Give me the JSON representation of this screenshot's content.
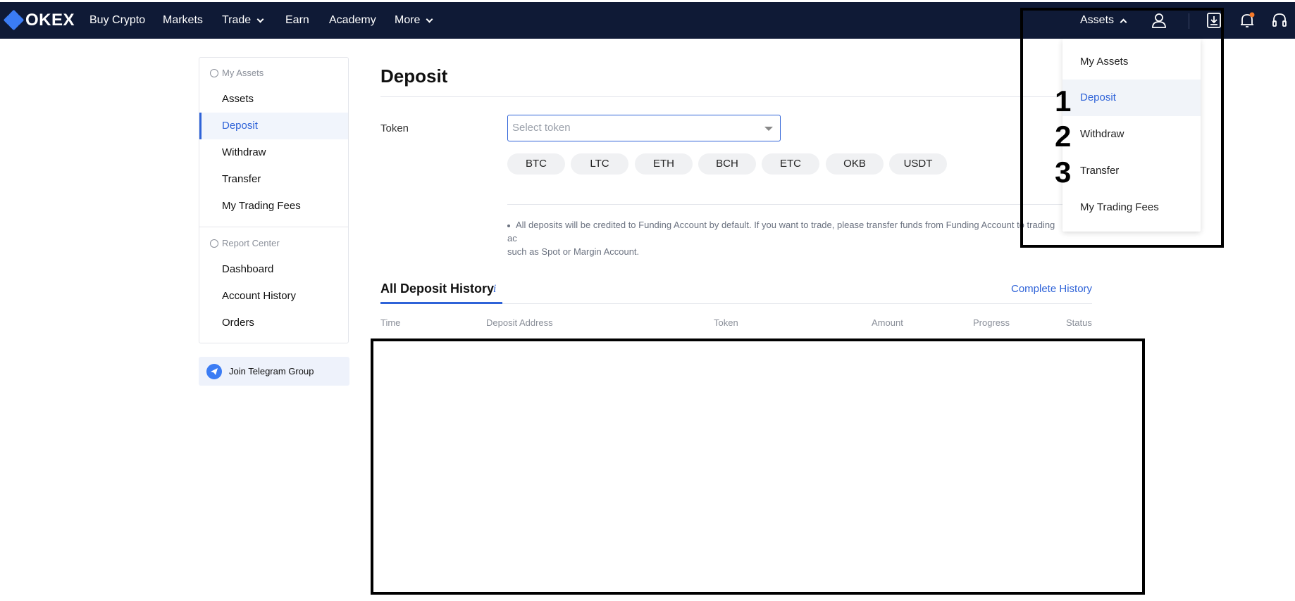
{
  "nav": {
    "logo_text": "OKEX",
    "items": [
      "Buy Crypto",
      "Markets",
      "Trade",
      "Earn",
      "Academy",
      "More"
    ],
    "assets_label": "Assets",
    "icons": [
      "user-icon",
      "download-icon",
      "bell-icon",
      "headset-icon"
    ],
    "accent_color": "#0f1a36"
  },
  "sidebar": {
    "section1": "My Assets",
    "items1": [
      "Assets",
      "Deposit",
      "Withdraw",
      "Transfer",
      "My Trading Fees"
    ],
    "section2": "Report Center",
    "items2": [
      "Dashboard",
      "Account History",
      "Orders"
    ],
    "telegram": "Join Telegram Group"
  },
  "main": {
    "title": "Deposit",
    "token_label": "Token",
    "token_placeholder": "Select token",
    "tokens": [
      "BTC",
      "LTC",
      "ETH",
      "BCH",
      "ETC",
      "OKB",
      "USDT"
    ],
    "note_line1": "All deposits will be credited to Funding Account by default. If you want to trade, please transfer funds from Funding Account to trading ac",
    "note_line2": "such as Spot or Margin Account.",
    "history_title": "All Deposit History",
    "history_info": "i",
    "complete_history": "Complete History",
    "columns": [
      "Time",
      "Deposit Address",
      "Token",
      "Amount",
      "Progress",
      "Status"
    ]
  },
  "dropdown": {
    "items": [
      "My Assets",
      "Deposit",
      "Withdraw",
      "Transfer",
      "My Trading Fees"
    ],
    "active": "Deposit"
  },
  "markers": [
    "1",
    "2",
    "3"
  ]
}
